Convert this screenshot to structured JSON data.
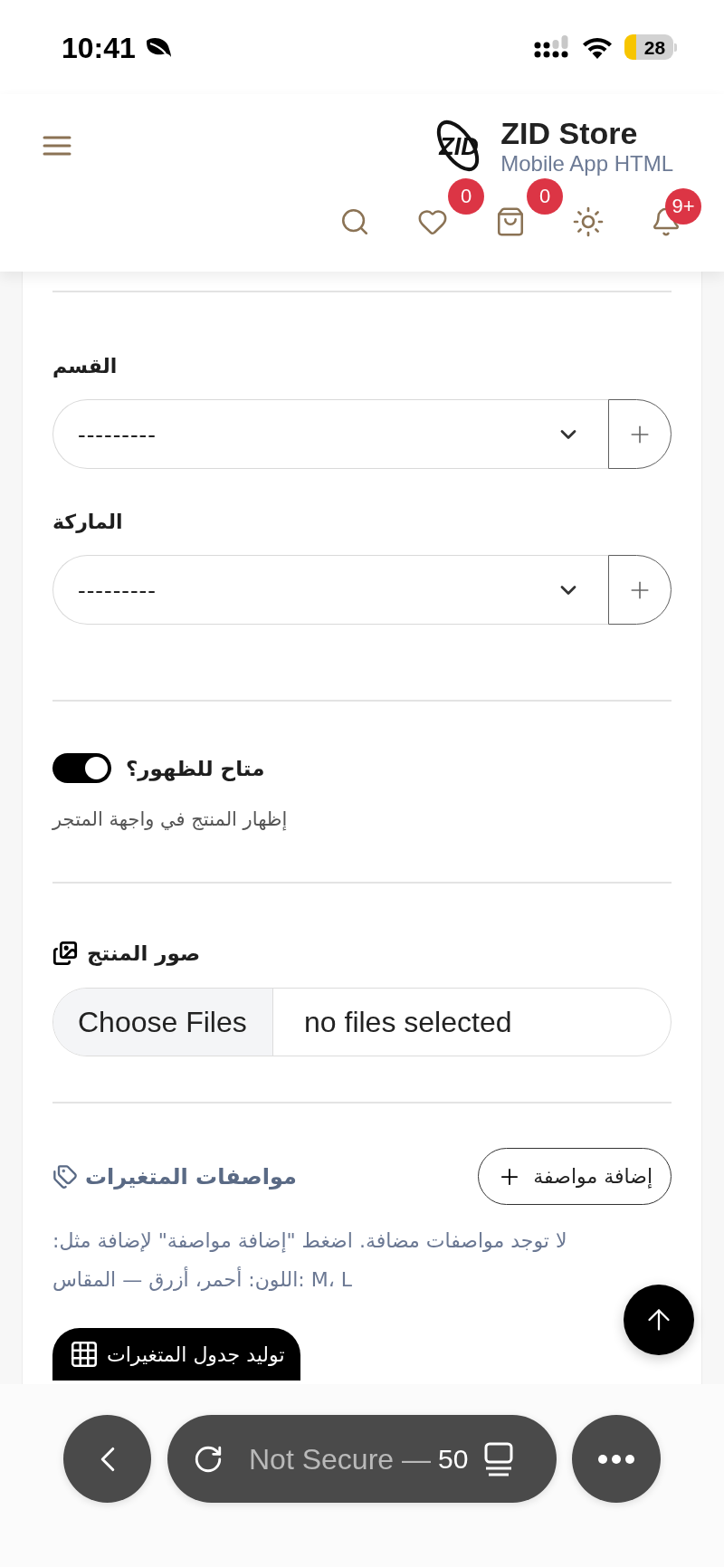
{
  "status_bar": {
    "time": "10:41",
    "battery": "28"
  },
  "header": {
    "logo_text": "ZID",
    "title": "ZID Store",
    "subtitle": "Mobile App HTML",
    "wishlist_count": "0",
    "cart_count": "0",
    "notifications_count": "9+"
  },
  "form": {
    "selects": [
      {
        "label": "القسم",
        "value": "---------"
      },
      {
        "label": "الماركة",
        "value": "---------"
      }
    ],
    "visibility": {
      "label": "متاح للظهور؟",
      "on": true,
      "hint": "إظهار المنتج في واجهة المتجر"
    },
    "images": {
      "label": "صور المنتج",
      "button": "Choose Files",
      "status": "no files selected"
    },
    "variants": {
      "title": "مواصفات المتغيرات",
      "add_button": "إضافة مواصفة",
      "empty_text": "لا توجد مواصفات مضافة. اضغط \"إضافة مواصفة\" لإضافة مثل: اللون: أحمر، أزرق — المقاس: M، L",
      "generate_button": "توليد جدول المتغيرات"
    }
  },
  "browser_bar": {
    "address": "Not Secure —",
    "address_tail": "50"
  }
}
